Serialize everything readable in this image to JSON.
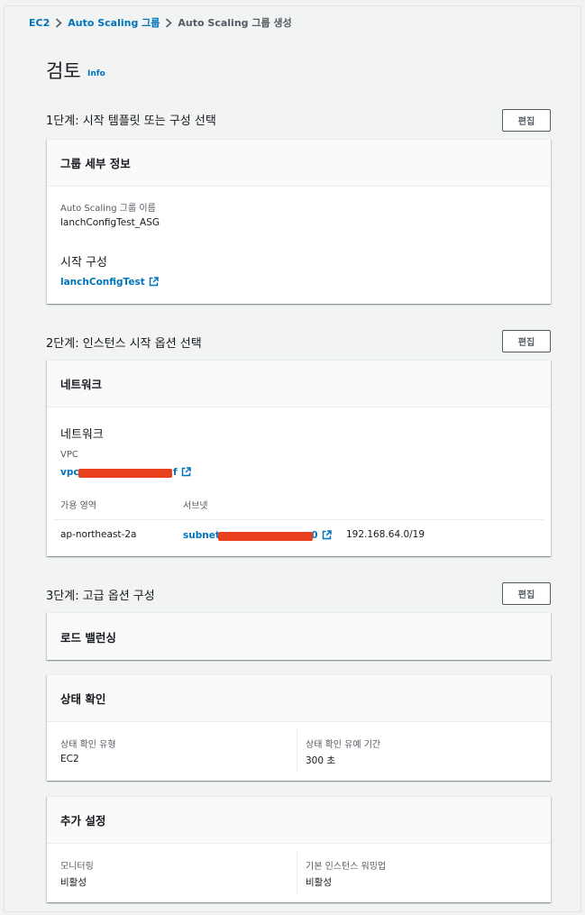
{
  "breadcrumb": {
    "items": [
      "EC2",
      "Auto Scaling 그룹",
      "Auto Scaling 그룹 생성"
    ]
  },
  "page": {
    "title": "검토",
    "info": "Info",
    "edit_label": "편집"
  },
  "step1": {
    "title": "1단계: 시작 템플릿 또는 구성 선택",
    "card_title": "그룹 세부 정보",
    "group_name_label": "Auto Scaling 그룹 이름",
    "group_name_value": "lanchConfigTest_ASG",
    "launch_config_heading": "시작 구성",
    "launch_config_link": "lanchConfigTest"
  },
  "step2": {
    "title": "2단계: 인스턴스 시작 옵션 선택",
    "card_title": "네트워크",
    "network_heading": "네트워크",
    "vpc_label": "VPC",
    "vpc_prefix": "vpc-",
    "vpc_suffix": "f",
    "table": {
      "headers": [
        "가용 영역",
        "서브넷"
      ],
      "rows": [
        {
          "az": "ap-northeast-2a",
          "subnet_prefix": "subnet-",
          "subnet_suffix": "0",
          "cidr": "192.168.64.0/19"
        }
      ]
    }
  },
  "step3": {
    "title": "3단계: 고급 옵션 구성",
    "lb_card_title": "로드 밸런싱",
    "health_card_title": "상태 확인",
    "health_type_label": "상태 확인 유형",
    "health_type_value": "EC2",
    "health_grace_label": "상태 확인 유예 기간",
    "health_grace_value": "300 초",
    "extra_card_title": "추가 설정",
    "monitoring_label": "모니터링",
    "monitoring_value": "비활성",
    "warmup_label": "기본 인스턴스 워밍업",
    "warmup_value": "비활성"
  },
  "colors": {
    "link": "#0073bb",
    "redaction": "#e8401c",
    "text": "#16191f",
    "muted": "#545b64"
  },
  "icons": [
    "chevron-right-icon",
    "external-link-icon"
  ]
}
